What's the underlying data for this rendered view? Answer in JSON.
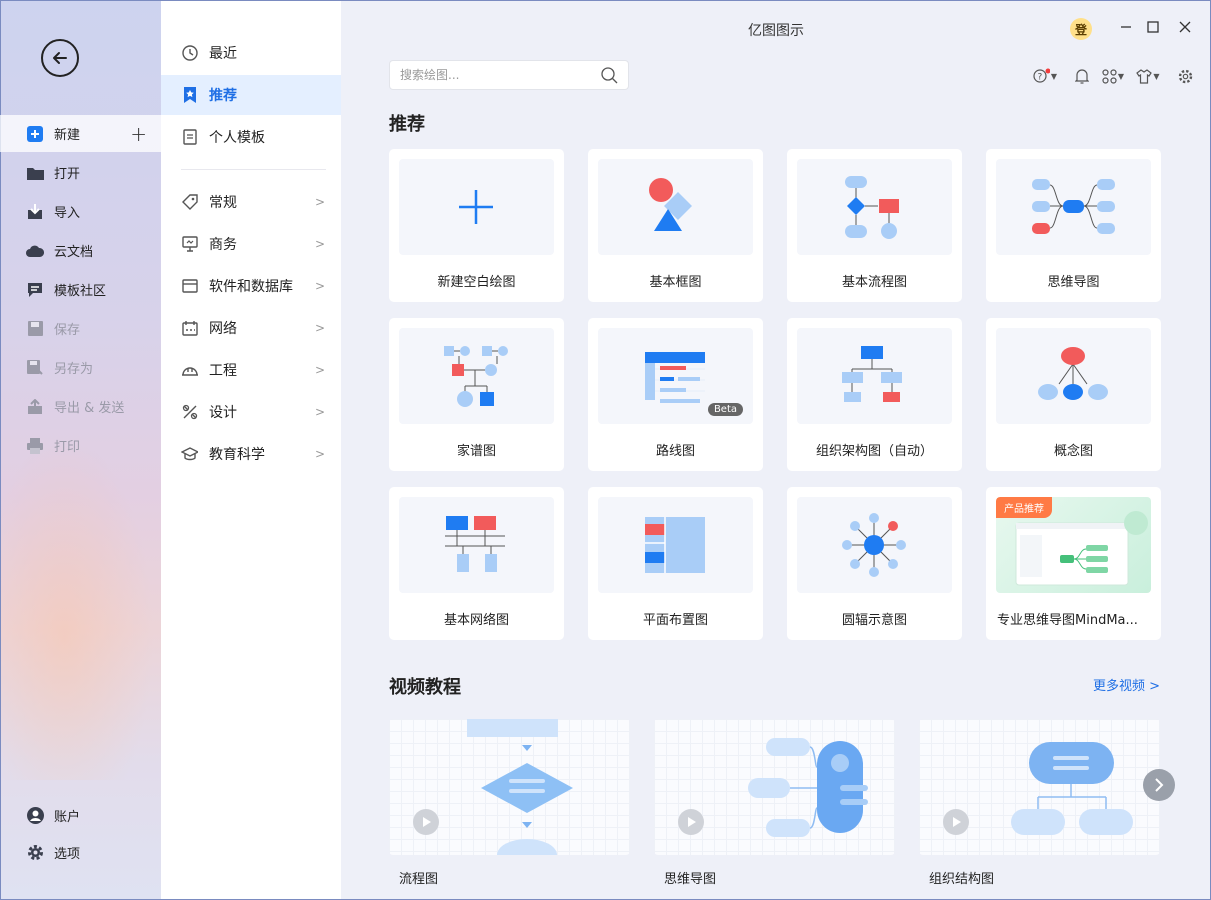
{
  "app": {
    "title": "亿图图示",
    "avatar_char": "登"
  },
  "rail": {
    "items": [
      {
        "label": "新建"
      },
      {
        "label": "打开"
      },
      {
        "label": "导入"
      },
      {
        "label": "云文档"
      },
      {
        "label": "模板社区"
      },
      {
        "label": "保存"
      },
      {
        "label": "另存为"
      },
      {
        "label": "导出 & 发送"
      },
      {
        "label": "打印"
      }
    ],
    "account": "账户",
    "options": "选项"
  },
  "categories": {
    "items": [
      {
        "label": "最近"
      },
      {
        "label": "推荐"
      },
      {
        "label": "个人模板"
      },
      {
        "label": "常规"
      },
      {
        "label": "商务"
      },
      {
        "label": "软件和数据库"
      },
      {
        "label": "网络"
      },
      {
        "label": "工程"
      },
      {
        "label": "设计"
      },
      {
        "label": "教育科学"
      }
    ]
  },
  "search": {
    "placeholder": "搜索绘图..."
  },
  "recommend": {
    "title": "推荐",
    "cards": [
      {
        "label": "新建空白绘图"
      },
      {
        "label": "基本框图"
      },
      {
        "label": "基本流程图"
      },
      {
        "label": "思维导图"
      },
      {
        "label": "家谱图"
      },
      {
        "label": "路线图",
        "badge": "Beta"
      },
      {
        "label": "组织架构图（自动）"
      },
      {
        "label": "概念图"
      },
      {
        "label": "基本网络图"
      },
      {
        "label": "平面布置图"
      },
      {
        "label": "圆辐示意图"
      },
      {
        "label": "专业思维导图MindMa...",
        "tag": "产品推荐"
      }
    ]
  },
  "videos": {
    "title": "视频教程",
    "more": "更多视频 >",
    "items": [
      {
        "label": "流程图"
      },
      {
        "label": "思维导图"
      },
      {
        "label": "组织结构图"
      }
    ]
  },
  "colors": {
    "accent": "#1f6fe5",
    "red": "#f25b5b",
    "light_blue": "#a9cdf7",
    "blue": "#1f7cf2"
  }
}
